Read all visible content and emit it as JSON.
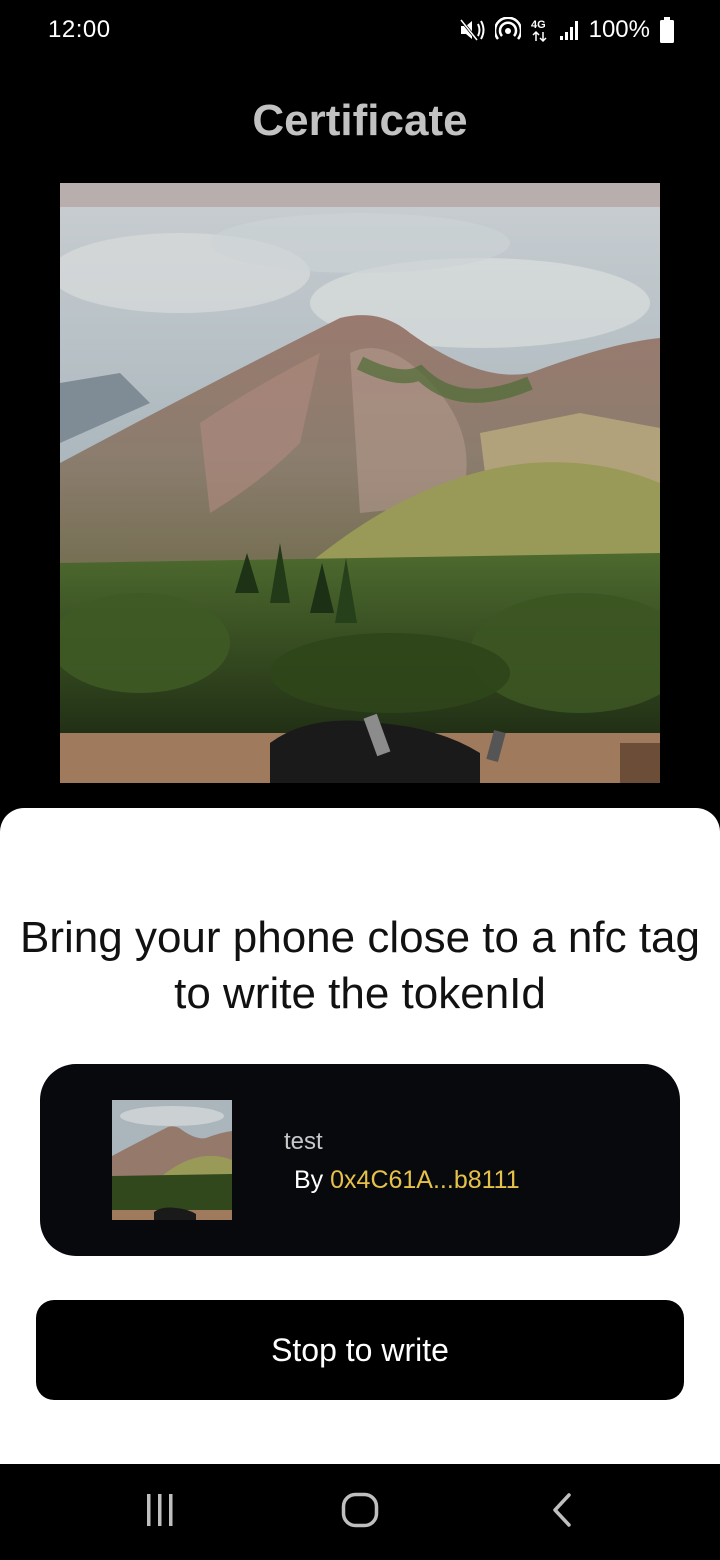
{
  "status_bar": {
    "time": "12:00",
    "battery": "100%",
    "network": "4G",
    "icons": [
      "mute-icon",
      "hotspot-icon",
      "network-4g-icon",
      "signal-icon",
      "battery-icon"
    ]
  },
  "header": {
    "title": "Certificate"
  },
  "artwork": {
    "description_icon": "artwork-image"
  },
  "sheet": {
    "message": "Bring your phone close to a nfc tag to write the tokenId",
    "token": {
      "name": "test",
      "by_label": "By",
      "owner_address": "0x4C61A...b8111"
    },
    "stop_button_label": "Stop to write"
  },
  "nav_bar": {
    "icons": [
      "recent-apps-icon",
      "home-icon",
      "back-icon"
    ]
  },
  "colors": {
    "background": "#000000",
    "sheet": "#ffffff",
    "card": "#08090d",
    "accent_address": "#e5c14a",
    "title": "#c2c2c2"
  }
}
